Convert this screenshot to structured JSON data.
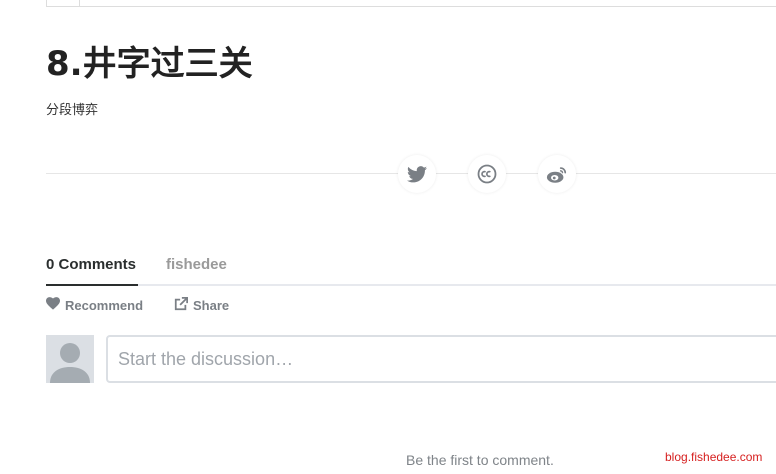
{
  "post": {
    "title": "8.井字过三关",
    "subtitle": "分段博弈"
  },
  "share": {
    "buttons": [
      {
        "icon": "twitter-icon"
      },
      {
        "icon": "creative-commons-icon"
      },
      {
        "icon": "weibo-icon"
      }
    ]
  },
  "comments": {
    "tabs": {
      "comments_label": "0 Comments",
      "site_label": "fishedee"
    },
    "actions": {
      "recommend_label": "Recommend",
      "share_label": "Share"
    },
    "input_placeholder": "Start the discussion…",
    "empty_message": "Be the first to comment."
  },
  "watermark": "blog.fishedee.com",
  "colors": {
    "title": "#222222",
    "tab_active": "#2a2e2e",
    "tab_inactive": "#9a9a9a",
    "action": "#7a7f85",
    "watermark": "#d62020"
  }
}
